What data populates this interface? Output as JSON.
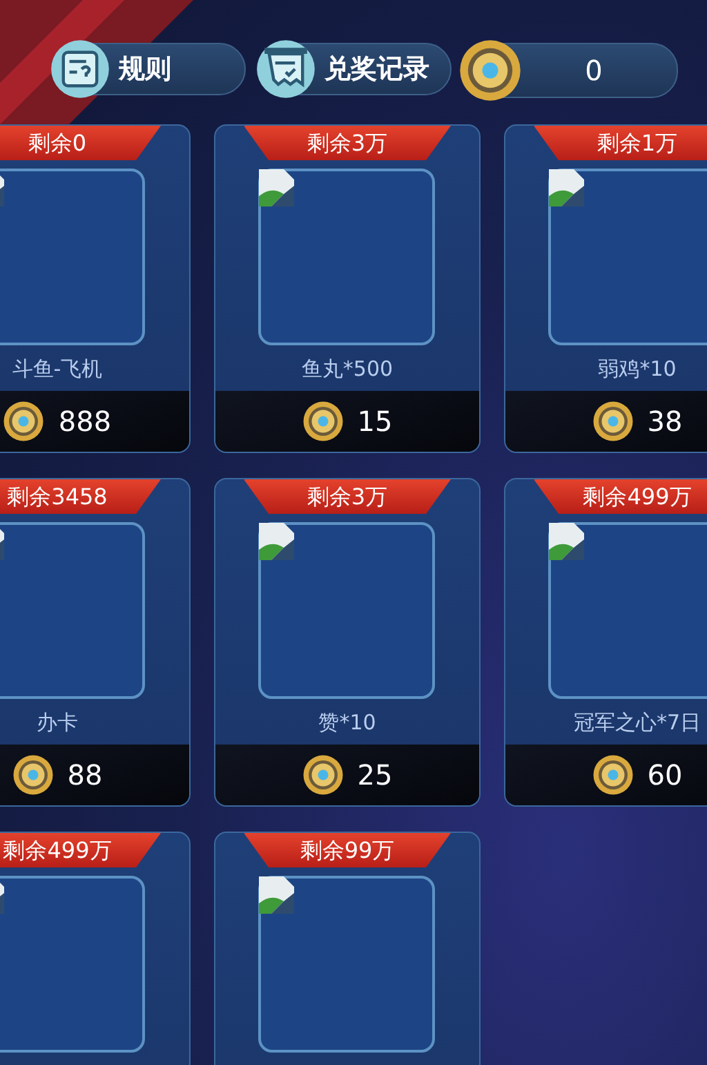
{
  "buttons": [
    {
      "label": "规则",
      "kind": "rules"
    },
    {
      "label": "兑奖记录",
      "kind": "records"
    }
  ],
  "balance": "0",
  "prizes": [
    {
      "remaining": "剩余0",
      "name": "斗鱼-飞机",
      "price": "888"
    },
    {
      "remaining": "剩余3万",
      "name": "鱼丸*500",
      "price": "15"
    },
    {
      "remaining": "剩余1万",
      "name": "弱鸡*10",
      "price": "38"
    },
    {
      "remaining": "剩余3458",
      "name": "办卡",
      "price": "88"
    },
    {
      "remaining": "剩余3万",
      "name": "赞*10",
      "price": "25"
    },
    {
      "remaining": "剩余499万",
      "name": "冠军之心*7日",
      "price": "60"
    },
    {
      "remaining": "剩余499万"
    },
    {
      "remaining": "剩余99万"
    }
  ]
}
